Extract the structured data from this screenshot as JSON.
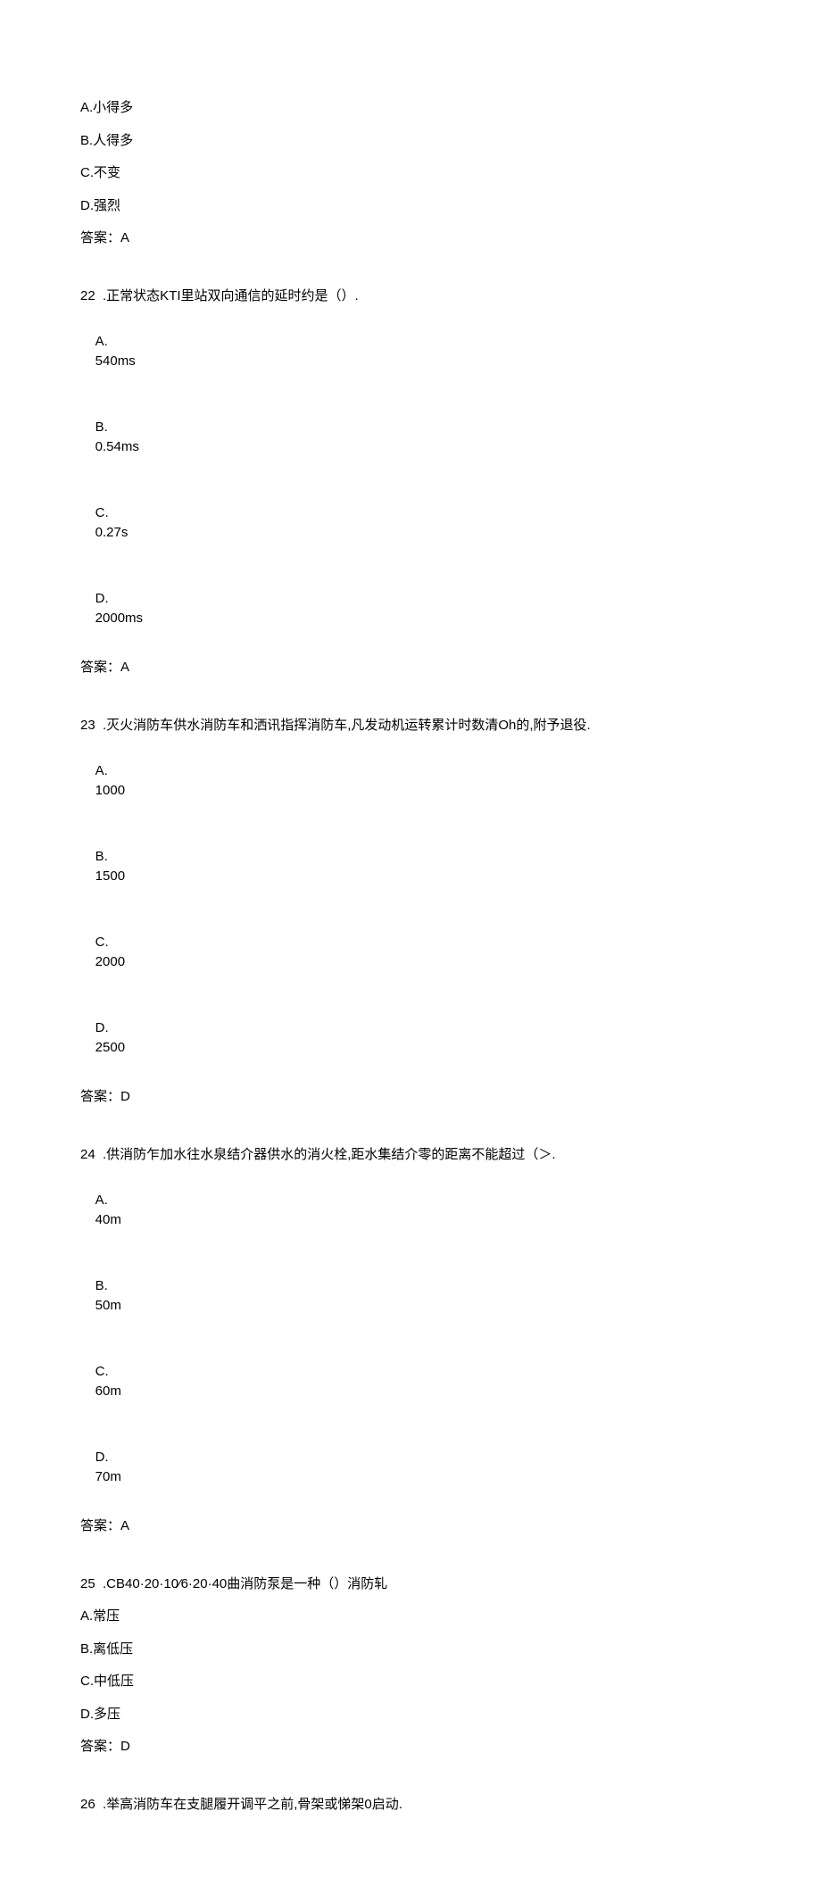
{
  "q21": {
    "options": {
      "a": "A.小得多",
      "b": "B.人得多",
      "c": "C.不变",
      "d": "D.强烈"
    },
    "answer": "答案：A"
  },
  "q22": {
    "stem": "22  .正常状态KTI里站双向通信的延时约是（）.",
    "options": {
      "a_letter": "A.",
      "a_text": "540ms",
      "b_letter": "B.",
      "b_text": "0.54ms",
      "c_letter": "C.",
      "c_text": "0.27s",
      "d_letter": "D.",
      "d_text": "2000ms"
    },
    "answer": "答案：A"
  },
  "q23": {
    "stem": "23  .灭火消防车供水消防车和洒讯指挥消防车,凡发动机运转累计时数清Oh的,附予退役.",
    "options": {
      "a_letter": "A.",
      "a_text": "1000",
      "b_letter": "B.",
      "b_text": "1500",
      "c_letter": "C.",
      "c_text": "2000",
      "d_letter": "D.",
      "d_text": "2500"
    },
    "answer": "答案：D"
  },
  "q24": {
    "stem": "24  .供消防乍加水往水泉结介器供水的消火栓,距水集结介零的距离不能超过（＞.",
    "options": {
      "a_letter": "A.",
      "a_text": "40m",
      "b_letter": "B.",
      "b_text": "50m",
      "c_letter": "C.",
      "c_text": "60m",
      "d_letter": "D.",
      "d_text": "70m"
    },
    "answer": "答案：A"
  },
  "q25": {
    "stem": "25  .CB40·20·10⁄6·20·40曲消防泵是一种（）消防轧",
    "options": {
      "a": "A.常压",
      "b": "B.离低压",
      "c": "C.中低压",
      "d": "D.多压"
    },
    "answer": "答案：D"
  },
  "q26": {
    "stem": "26  .举高消防车在支腿履开调平之前,骨架或悌架0启动."
  }
}
